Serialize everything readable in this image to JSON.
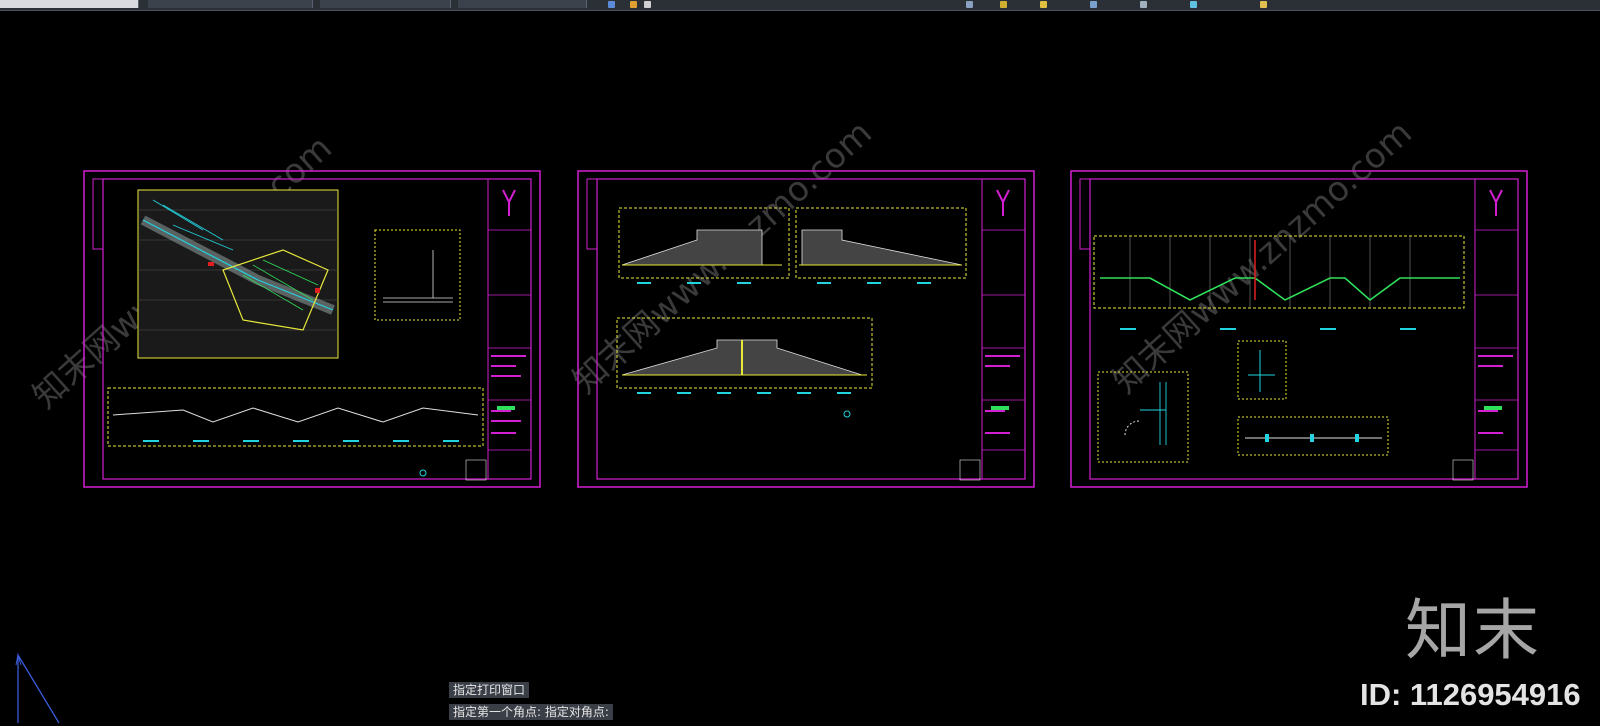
{
  "toolbar": {
    "tabs": [
      "",
      "",
      "",
      ""
    ],
    "icon_names": [
      "save-icon",
      "undo-icon",
      "redo-icon",
      "print-icon",
      "layer-icon",
      "properties-icon",
      "match-icon",
      "block-icon",
      "zoom-icon",
      "pan-icon"
    ]
  },
  "sheets": [
    {
      "id": "sheet-1",
      "layout": "plan-and-sections"
    },
    {
      "id": "sheet-2",
      "layout": "ramp-sections"
    },
    {
      "id": "sheet-3",
      "layout": "elevation-and-details"
    }
  ],
  "command_history": [
    "指定打印窗口",
    "指定第一个角点: 指定对角点:"
  ],
  "watermark": {
    "logo_text": "知末",
    "id_text": "ID: 1126954916",
    "site_text": "知末网www.znzmo.com"
  },
  "colors": {
    "background": "#000000",
    "sheet_border": "#d21fd2",
    "cyan": "#22d3e0",
    "yellow": "#e8e83a",
    "green": "#2ee05a",
    "white": "#e0e0e0",
    "red": "#e02020"
  }
}
